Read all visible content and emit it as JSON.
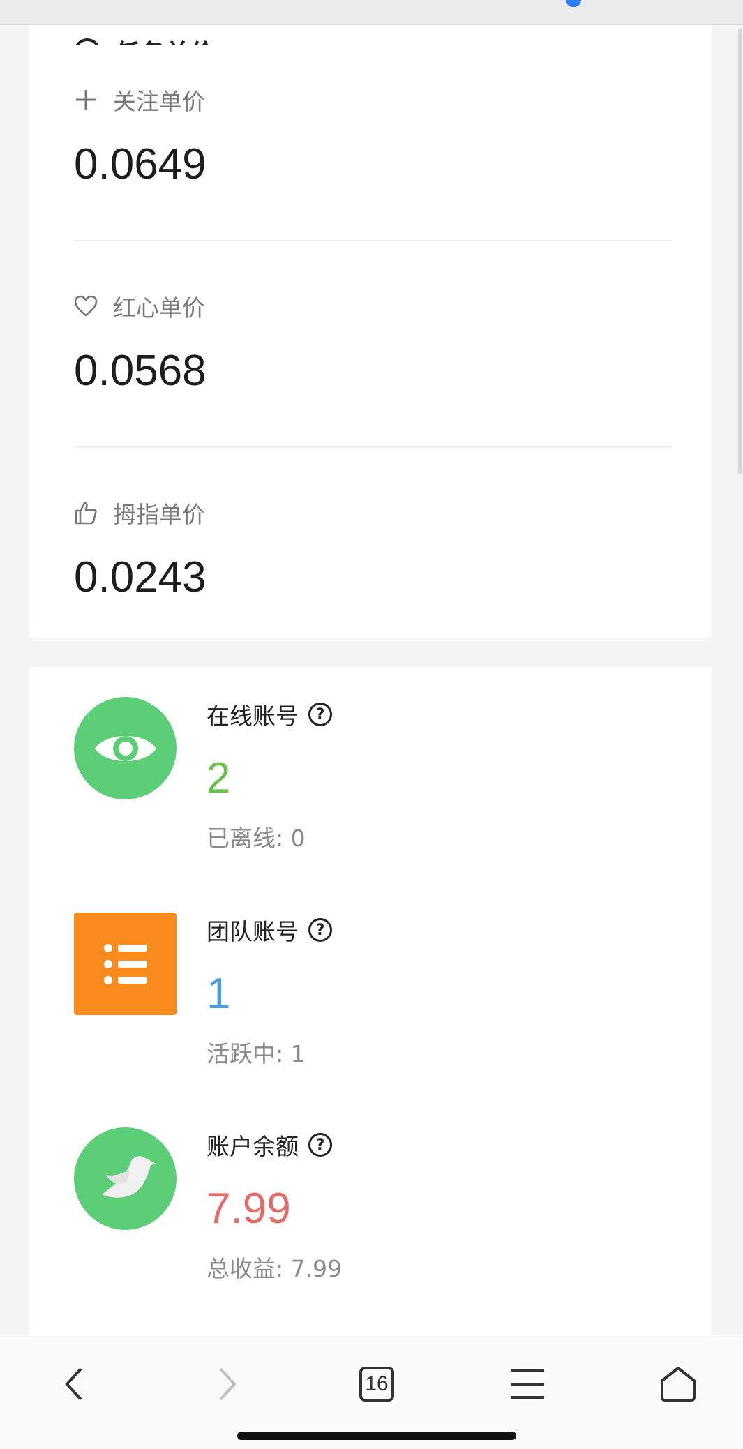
{
  "prices": {
    "title": "任务单价",
    "title_icon": "yen-circle-icon",
    "items": [
      {
        "label": "关注单价",
        "icon": "plus-icon",
        "value": "0.0649"
      },
      {
        "label": "红心单价",
        "icon": "heart-icon",
        "value": "0.0568"
      },
      {
        "label": "拇指单价",
        "icon": "thumbs-up-icon",
        "value": "0.0243"
      }
    ]
  },
  "stats": {
    "online": {
      "label": "在线账号",
      "help": "?",
      "value": "2",
      "sub": "已离线: 0",
      "color": "#6cbf4a",
      "icon": "eye-icon"
    },
    "team": {
      "label": "团队账号",
      "help": "?",
      "value": "1",
      "sub": "活跃中: 1",
      "color": "#4a9ae0",
      "icon": "list-icon"
    },
    "balance": {
      "label": "账户余额",
      "help": "?",
      "value": "7.99",
      "sub": "总收益: 7.99",
      "color": "#e06d68",
      "icon": "bird-icon"
    }
  },
  "browser": {
    "tab_count": "16"
  }
}
